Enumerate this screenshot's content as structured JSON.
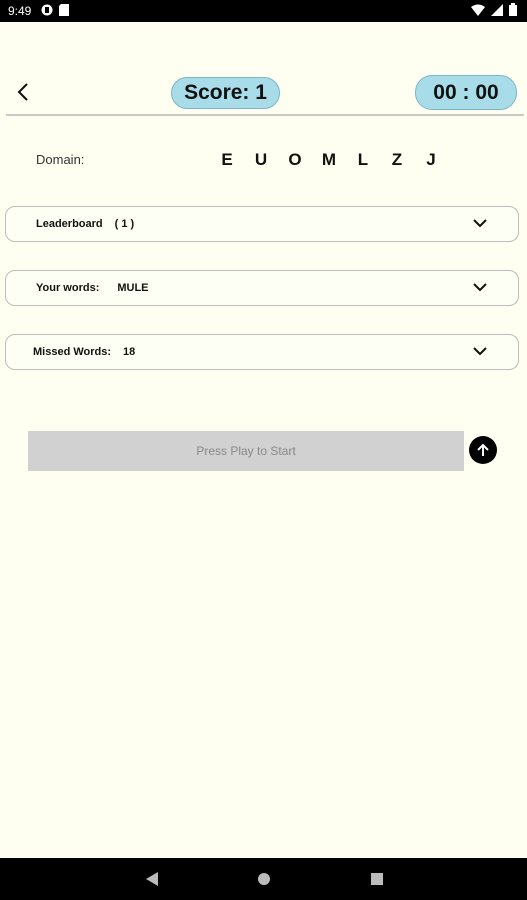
{
  "status_bar": {
    "time": "9:49",
    "icons": [
      "app-icon",
      "sd-card-icon"
    ],
    "right_icons": [
      "wifi-icon",
      "signal-icon",
      "battery-icon"
    ]
  },
  "header": {
    "score_text": "Score: 1",
    "timer_text": "00 : 00"
  },
  "domain": {
    "label": "Domain:",
    "letters": [
      "E",
      "U",
      "O",
      "M",
      "L",
      "Z",
      "J"
    ]
  },
  "leaderboard": {
    "label": "Leaderboard",
    "value": "( 1 )"
  },
  "your_words": {
    "label": "Your words:",
    "value": "MULE"
  },
  "missed_words": {
    "label": "Missed Words:",
    "value": "18"
  },
  "play_bar": {
    "text": "Press Play to Start"
  },
  "colors": {
    "background": "#fefff1",
    "pill": "#a8dce8",
    "play_bar": "#d1d1d1"
  }
}
